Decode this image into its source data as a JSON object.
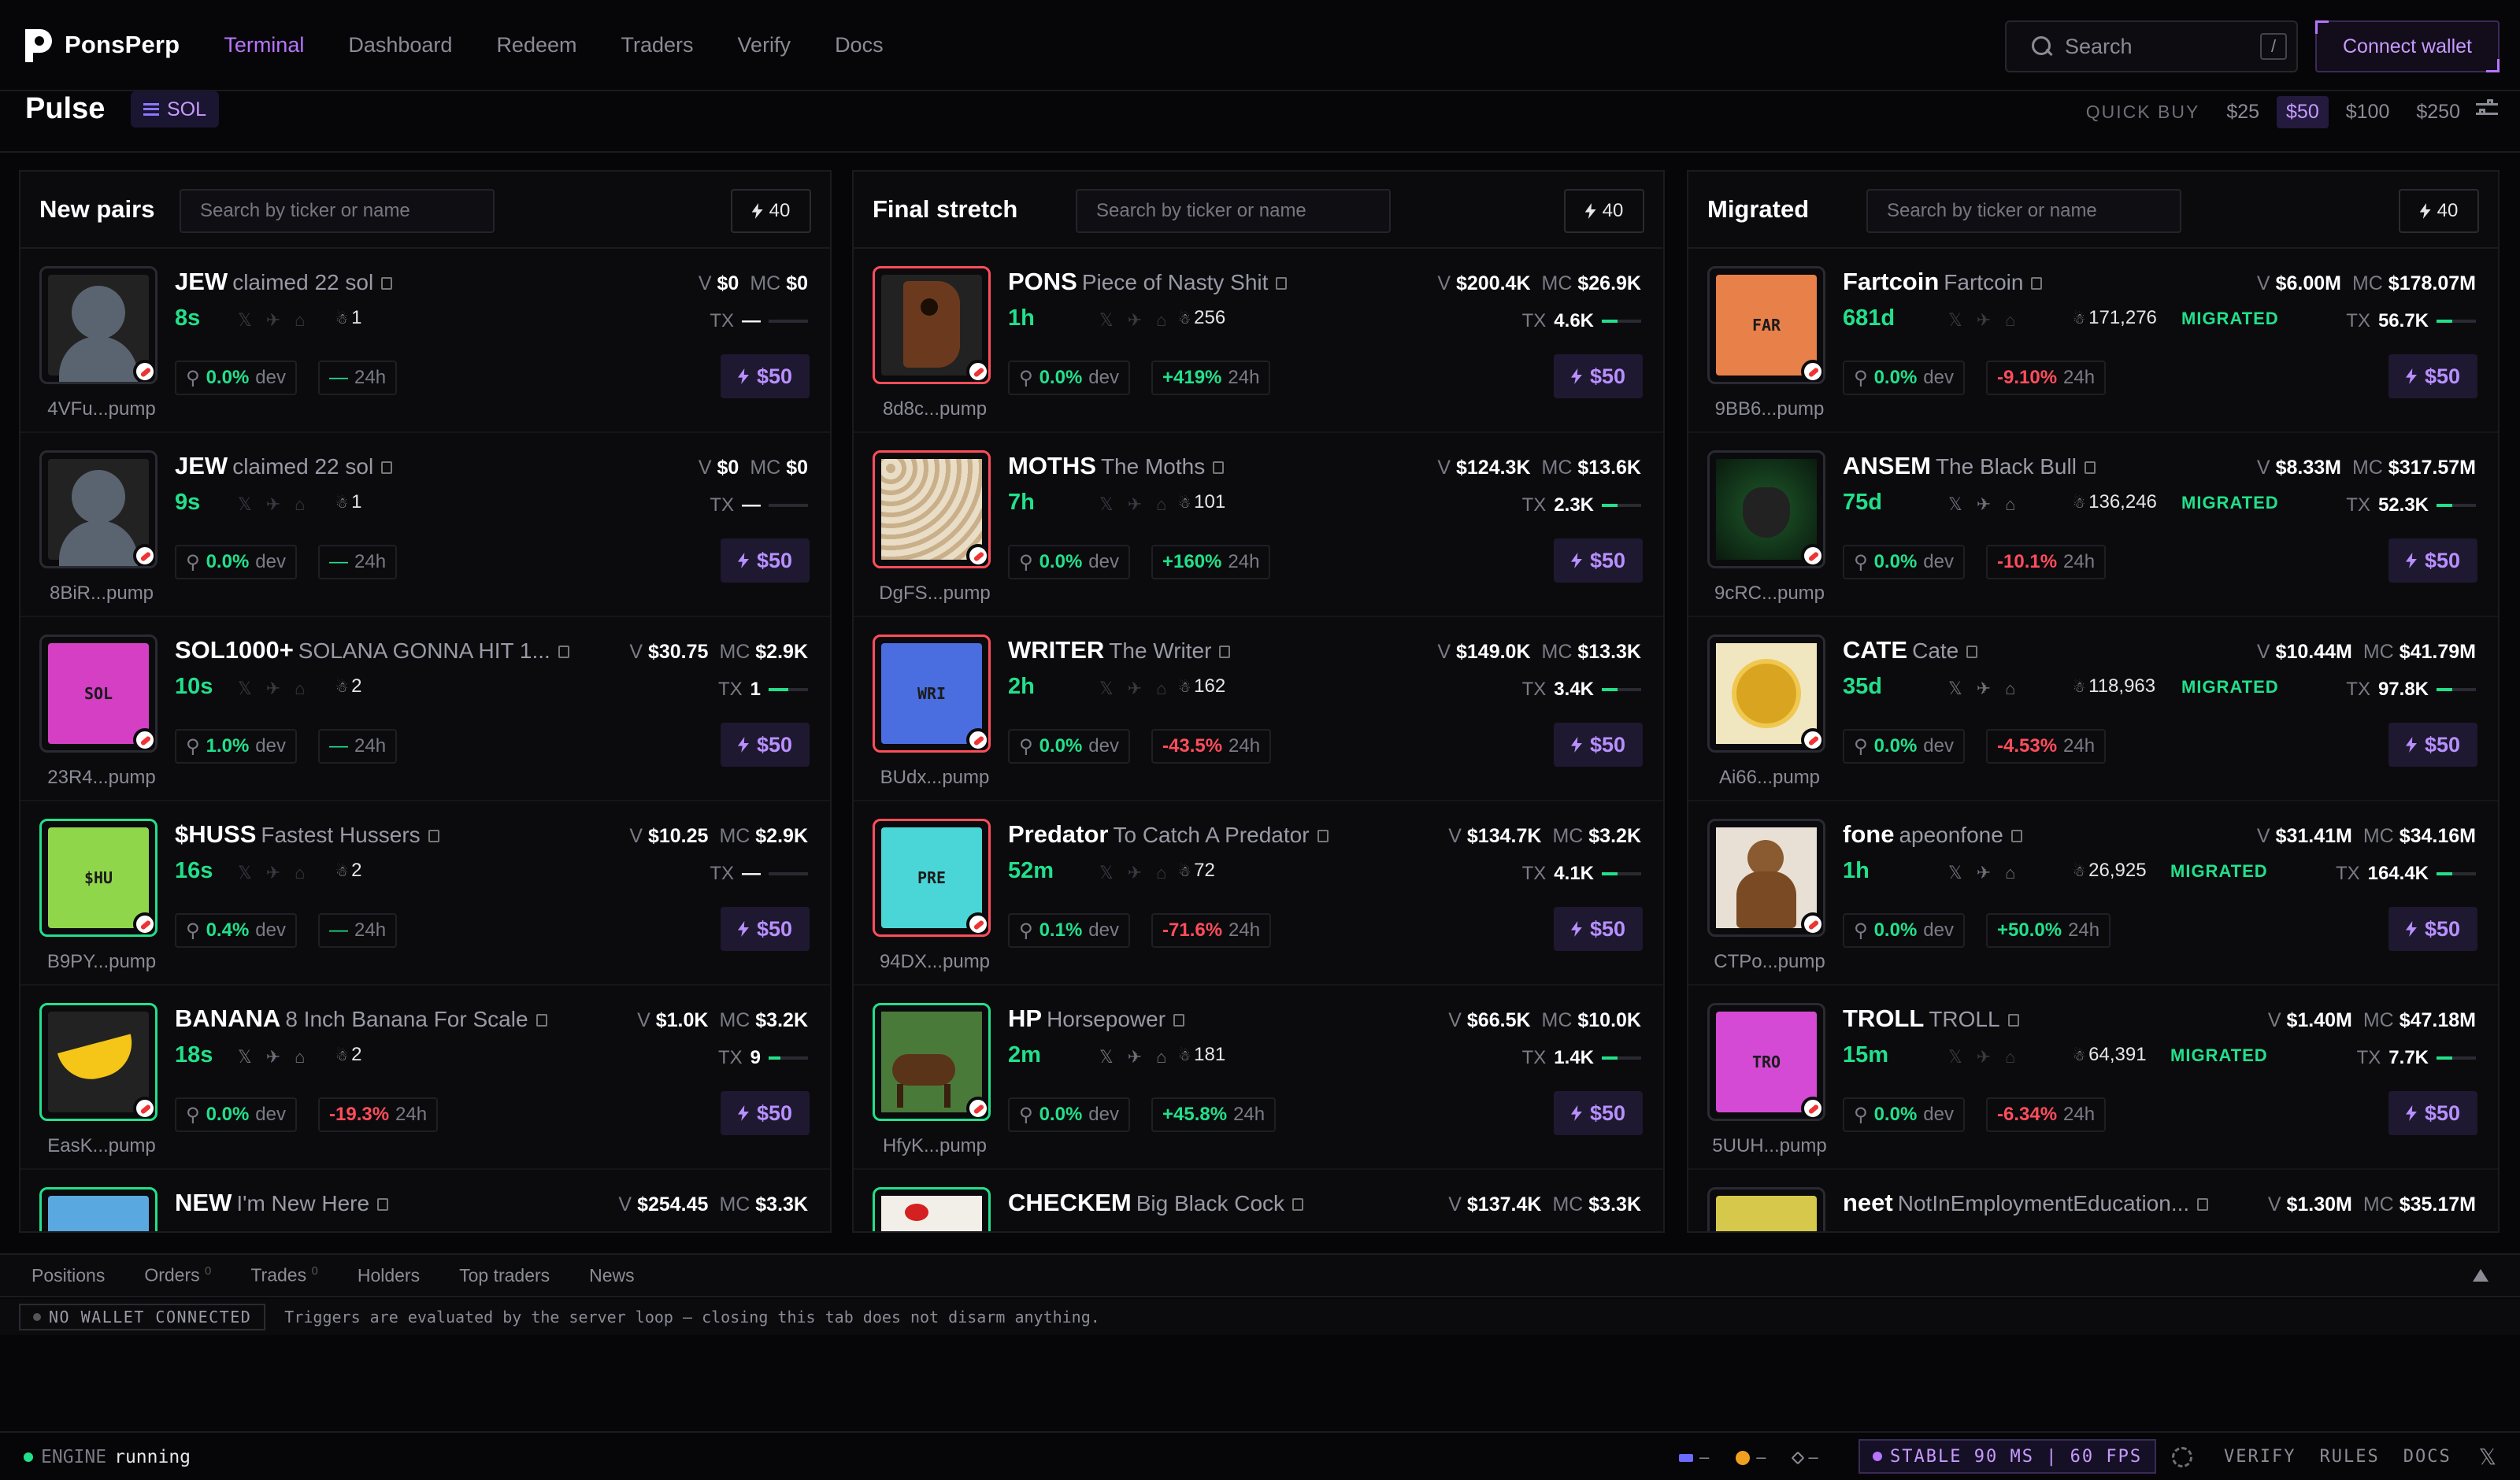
{
  "brand": {
    "name": "PonsPerp"
  },
  "nav": [
    {
      "label": "Terminal",
      "active": true
    },
    {
      "label": "Dashboard"
    },
    {
      "label": "Redeem"
    },
    {
      "label": "Traders"
    },
    {
      "label": "Verify"
    },
    {
      "label": "Docs"
    }
  ],
  "search": {
    "placeholder": "Search",
    "shortcut": "/"
  },
  "connect_label": "Connect wallet",
  "pulse": {
    "title": "Pulse",
    "chain": "SOL"
  },
  "quick_buy": {
    "label": "QUICK BUY",
    "amounts": [
      "$25",
      "$50",
      "$100",
      "$250"
    ],
    "selected": "$50"
  },
  "columns": [
    {
      "title": "New pairs",
      "search_placeholder": "Search by ticker or name",
      "count": "40",
      "rows": [
        {
          "ticker": "JEW",
          "name": "claimed 22 sol",
          "age": "8s",
          "holders": "1",
          "v": "$0",
          "mc": "$0",
          "tx": "—",
          "tx_fill": 0,
          "dev": "0.0%",
          "change": "—",
          "change_dir": "n",
          "addr": "4VFu...pump",
          "thumb": "avatar",
          "buy": "$50",
          "socials_lit": false,
          "migrated": false
        },
        {
          "ticker": "JEW",
          "name": "claimed 22 sol",
          "age": "9s",
          "holders": "1",
          "v": "$0",
          "mc": "$0",
          "tx": "—",
          "tx_fill": 0,
          "dev": "0.0%",
          "change": "—",
          "change_dir": "n",
          "addr": "8BiR...pump",
          "thumb": "avatar",
          "buy": "$50",
          "socials_lit": false,
          "migrated": false
        },
        {
          "ticker": "SOL1000+",
          "name": "SOLANA GONNA HIT 1...",
          "age": "10s",
          "holders": "2",
          "v": "$30.75",
          "mc": "$2.9K",
          "tx": "1",
          "tx_fill": 0.5,
          "dev": "1.0%",
          "change": "—",
          "change_dir": "n",
          "addr": "23R4...pump",
          "thumb": "SOL",
          "thumb_color": "#d43fc4",
          "buy": "$50",
          "socials_lit": false,
          "migrated": false
        },
        {
          "ticker": "$HUSS",
          "name": "Fastest Hussers",
          "age": "16s",
          "holders": "2",
          "v": "$10.25",
          "mc": "$2.9K",
          "tx": "—",
          "tx_fill": 0,
          "dev": "0.4%",
          "change": "—",
          "change_dir": "n",
          "addr": "B9PY...pump",
          "thumb": "$HU",
          "thumb_color": "#8fd64a",
          "buy": "$50",
          "socials_lit": false,
          "migrated": false
        },
        {
          "ticker": "BANANA",
          "name": "8 Inch Banana For Scale",
          "age": "18s",
          "holders": "2",
          "v": "$1.0K",
          "mc": "$3.2K",
          "tx": "9",
          "tx_fill": 0.3,
          "dev": "0.0%",
          "change": "-19.3%",
          "change_dir": "r",
          "addr": "EasK...pump",
          "thumb": "banana",
          "buy": "$50",
          "socials_lit": true,
          "migrated": false
        },
        {
          "ticker": "NEW",
          "name": "I'm New Here",
          "age": "",
          "holders": "",
          "v": "$254.45",
          "mc": "$3.3K",
          "tx": "",
          "tx_fill": 0,
          "dev": "",
          "change": "",
          "change_dir": "n",
          "addr": "",
          "thumb": "",
          "thumb_color": "#5aa8e0",
          "buy": "",
          "socials_lit": false,
          "migrated": false
        }
      ]
    },
    {
      "title": "Final stretch",
      "search_placeholder": "Search by ticker or name",
      "count": "40",
      "rows": [
        {
          "ticker": "PONS",
          "name": "Piece of Nasty Shit",
          "age": "1h",
          "holders": "256",
          "v": "$200.4K",
          "mc": "$26.9K",
          "tx": "4.6K",
          "tx_fill": 0.4,
          "dev": "0.0%",
          "change": "+419%",
          "change_dir": "g",
          "addr": "8d8c...pump",
          "thumb": "pons",
          "buy": "$50",
          "socials_lit": false,
          "migrated": false
        },
        {
          "ticker": "MOTHS",
          "name": "The Moths",
          "age": "7h",
          "holders": "101",
          "v": "$124.3K",
          "mc": "$13.6K",
          "tx": "2.3K",
          "tx_fill": 0.4,
          "dev": "0.0%",
          "change": "+160%",
          "change_dir": "g",
          "addr": "DgFS...pump",
          "thumb": "moths",
          "buy": "$50",
          "socials_lit": false,
          "migrated": false
        },
        {
          "ticker": "WRITER",
          "name": "The Writer",
          "age": "2h",
          "holders": "162",
          "v": "$149.0K",
          "mc": "$13.3K",
          "tx": "3.4K",
          "tx_fill": 0.4,
          "dev": "0.0%",
          "change": "-43.5%",
          "change_dir": "r",
          "addr": "BUdx...pump",
          "thumb": "WRI",
          "thumb_color": "#4a6ee0",
          "buy": "$50",
          "socials_lit": false,
          "migrated": false
        },
        {
          "ticker": "Predator",
          "name": "To Catch A Predator",
          "age": "52m",
          "holders": "72",
          "v": "$134.7K",
          "mc": "$3.2K",
          "tx": "4.1K",
          "tx_fill": 0.4,
          "dev": "0.1%",
          "change": "-71.6%",
          "change_dir": "r",
          "addr": "94DX...pump",
          "thumb": "PRE",
          "thumb_color": "#4ad6d6",
          "buy": "$50",
          "socials_lit": false,
          "migrated": false
        },
        {
          "ticker": "HP",
          "name": "Horsepower",
          "age": "2m",
          "holders": "181",
          "v": "$66.5K",
          "mc": "$10.0K",
          "tx": "1.4K",
          "tx_fill": 0.4,
          "dev": "0.0%",
          "change": "+45.8%",
          "change_dir": "g",
          "addr": "HfyK...pump",
          "thumb": "horse",
          "buy": "$50",
          "socials_lit": true,
          "migrated": false
        },
        {
          "ticker": "CHECKEM",
          "name": "Big Black Cock",
          "age": "",
          "holders": "",
          "v": "$137.4K",
          "mc": "$3.3K",
          "tx": "",
          "tx_fill": 0,
          "dev": "",
          "change": "",
          "change_dir": "n",
          "addr": "",
          "thumb": "rooster",
          "buy": "",
          "socials_lit": false,
          "migrated": false
        }
      ]
    },
    {
      "title": "Migrated",
      "search_placeholder": "Search by ticker or name",
      "count": "40",
      "rows": [
        {
          "ticker": "Fartcoin",
          "name": "Fartcoin",
          "age": "681d",
          "holders": "171,276",
          "v": "$6.00M",
          "mc": "$178.07M",
          "tx": "56.7K",
          "tx_fill": 0.4,
          "dev": "0.0%",
          "change": "-9.10%",
          "change_dir": "r",
          "addr": "9BB6...pump",
          "thumb": "FAR",
          "thumb_color": "#e8804a",
          "buy": "$50",
          "socials_lit": false,
          "migrated": true
        },
        {
          "ticker": "ANSEM",
          "name": "The Black Bull",
          "age": "75d",
          "holders": "136,246",
          "v": "$8.33M",
          "mc": "$317.57M",
          "tx": "52.3K",
          "tx_fill": 0.4,
          "dev": "0.0%",
          "change": "-10.1%",
          "change_dir": "r",
          "addr": "9cRC...pump",
          "thumb": "bull",
          "buy": "$50",
          "socials_lit": true,
          "migrated": true
        },
        {
          "ticker": "CATE",
          "name": "Cate",
          "age": "35d",
          "holders": "118,963",
          "v": "$10.44M",
          "mc": "$41.79M",
          "tx": "97.8K",
          "tx_fill": 0.4,
          "dev": "0.0%",
          "change": "-4.53%",
          "change_dir": "r",
          "addr": "Ai66...pump",
          "thumb": "coin",
          "buy": "$50",
          "socials_lit": true,
          "migrated": true
        },
        {
          "ticker": "fone",
          "name": "apeonfone",
          "age": "1h",
          "holders": "26,925",
          "v": "$31.41M",
          "mc": "$34.16M",
          "tx": "164.4K",
          "tx_fill": 0.4,
          "dev": "0.0%",
          "change": "+50.0%",
          "change_dir": "g",
          "addr": "CTPo...pump",
          "thumb": "monkey",
          "buy": "$50",
          "socials_lit": true,
          "migrated": true
        },
        {
          "ticker": "TROLL",
          "name": "TROLL",
          "age": "15m",
          "holders": "64,391",
          "v": "$1.40M",
          "mc": "$47.18M",
          "tx": "7.7K",
          "tx_fill": 0.4,
          "dev": "0.0%",
          "change": "-6.34%",
          "change_dir": "r",
          "addr": "5UUH...pump",
          "thumb": "TRO",
          "thumb_color": "#d44ad4",
          "buy": "$50",
          "socials_lit": false,
          "migrated": true
        },
        {
          "ticker": "neet",
          "name": "NotInEmploymentEducation...",
          "age": "",
          "holders": "",
          "v": "$1.30M",
          "mc": "$35.17M",
          "tx": "",
          "tx_fill": 0,
          "dev": "",
          "change": "",
          "change_dir": "n",
          "addr": "",
          "thumb": "",
          "thumb_color": "#d6c84a",
          "buy": "",
          "socials_lit": false,
          "migrated": false
        }
      ]
    }
  ],
  "labels": {
    "v": "V",
    "mc": "MC",
    "tx": "TX",
    "dev": "dev",
    "h24": "24h",
    "migrated": "MIGRATED"
  },
  "bottom_tabs": [
    {
      "label": "Positions"
    },
    {
      "label": "Orders",
      "count": "0"
    },
    {
      "label": "Trades",
      "count": "0"
    },
    {
      "label": "Holders"
    },
    {
      "label": "Top traders"
    },
    {
      "label": "News"
    }
  ],
  "status": {
    "wallet": "NO WALLET CONNECTED",
    "message": "Triggers are evaluated by the server loop — closing this tab does not disarm anything."
  },
  "footer": {
    "engine_label": "ENGINE",
    "engine_state": "running",
    "sol": "–",
    "btc": "–",
    "eth": "–",
    "stable": "STABLE 90 MS | 60 FPS",
    "links": [
      "VERIFY",
      "RULES",
      "DOCS"
    ]
  },
  "colors": {
    "accent": "#b774ff",
    "green": "#22e08a",
    "red": "#ff4d5a"
  }
}
